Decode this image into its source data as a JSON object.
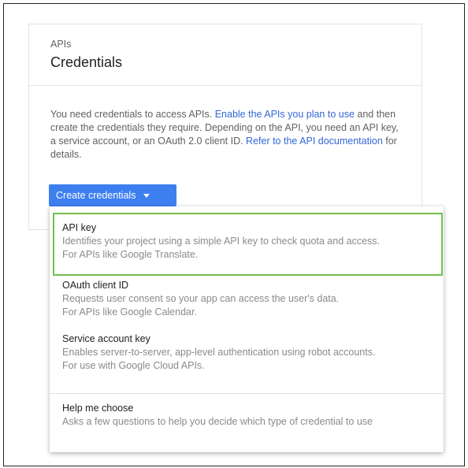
{
  "card": {
    "eyebrow": "APIs",
    "title": "Credentials",
    "description": {
      "part1": "You need credentials to access APIs. ",
      "link1": "Enable the APIs you plan to use",
      "part2": " and then create the credentials they require. Depending on the API, you need an API key, a service account, or an OAuth 2.0 client ID. ",
      "link2": "Refer to the API documentation",
      "part3": " for details."
    },
    "create_button_label": "Create credentials"
  },
  "menu": {
    "items": [
      {
        "title": "API key",
        "line1": "Identifies your project using a simple API key to check quota and access.",
        "line2": "For APIs like Google Translate."
      },
      {
        "title": "OAuth client ID",
        "line1": "Requests user consent so your app can access the user's data.",
        "line2": "For APIs like Google Calendar."
      },
      {
        "title": "Service account key",
        "line1": "Enables server-to-server, app-level authentication using robot accounts.",
        "line2": "For use with Google Cloud APIs."
      },
      {
        "title": "Help me choose",
        "line1": "Asks a few questions to help you decide which type of credential to use"
      }
    ]
  },
  "colors": {
    "primary_button": "#3e7ff0",
    "link": "#3367d6",
    "highlight_border": "#72be4e"
  }
}
